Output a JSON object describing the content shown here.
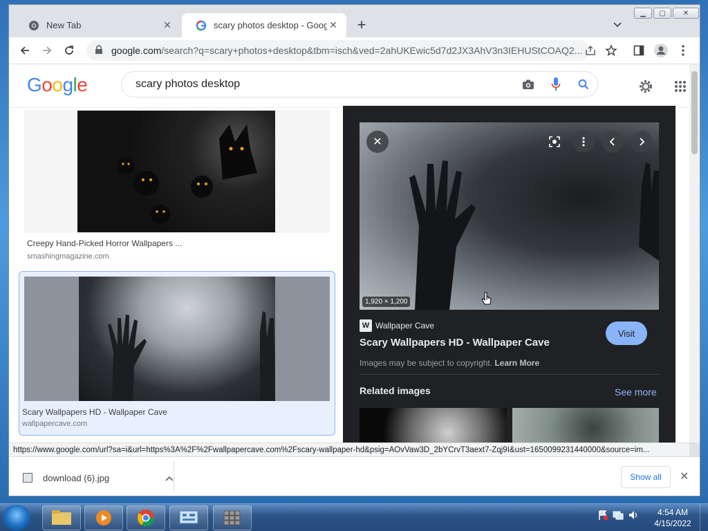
{
  "browser": {
    "tabs": [
      {
        "title": "New Tab",
        "active": false
      },
      {
        "title": "scary photos desktop - Google Search",
        "active": true
      }
    ],
    "address": {
      "domain": "google.com",
      "path": "/search?q=scary+photos+desktop&tbm=isch&ved=2ahUKEwic5d7d2JX3AhV3n3IEHUStCOAQ2..."
    }
  },
  "search": {
    "logo": "Google",
    "query": "scary photos desktop"
  },
  "results": [
    {
      "title": "Creepy Hand-Picked Horror Wallpapers ...",
      "source": "smashingmagazine.com"
    },
    {
      "title": "Scary Wallpapers HD - Wallpaper Cave",
      "source": "wallpapercave.com"
    }
  ],
  "panel": {
    "dimensions": "1,920 × 1,200",
    "site_name": "Wallpaper Cave",
    "site_logo": "W",
    "title": "Scary Wallpapers HD - Wallpaper Cave",
    "visit_label": "Visit",
    "copyright_text": "Images may be subject to copyright.",
    "learn_more": "Learn More",
    "related_heading": "Related images",
    "see_more": "See more"
  },
  "status_url": "https://www.google.com/url?sa=i&url=https%3A%2F%2Fwallpapercave.com%2Fscary-wallpaper-hd&psig=AOvVaw3D_2bYCrvT3aext7-Zqj9I&ust=1650099231440000&source=im...",
  "downloads": {
    "items": [
      {
        "name": "download (6).jpg"
      }
    ],
    "show_all": "Show all"
  },
  "taskbar": {
    "time": "4:54 AM",
    "date": "4/15/2022"
  },
  "colors": {
    "accent": "#1a73e8",
    "panel_bg": "#202124",
    "visit_btn": "#8ab4f8"
  }
}
